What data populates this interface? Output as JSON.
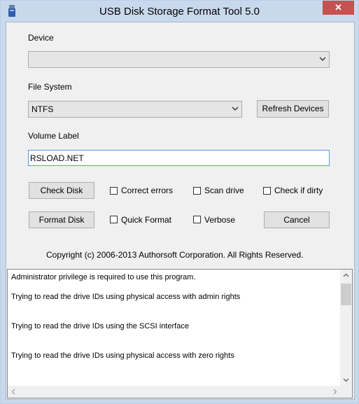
{
  "window": {
    "title": "USB Disk Storage Format Tool 5.0",
    "close_glyph": "✕",
    "app_icon": "usb-drive-icon"
  },
  "device": {
    "label": "Device",
    "selected": ""
  },
  "file_system": {
    "label": "File System",
    "selected": "NTFS"
  },
  "buttons": {
    "refresh": "Refresh Devices",
    "check_disk": "Check Disk",
    "format_disk": "Format Disk",
    "cancel": "Cancel"
  },
  "volume_label": {
    "label": "Volume Label",
    "value": "RSLOAD.NET"
  },
  "options": {
    "correct_errors": "Correct errors",
    "scan_drive": "Scan drive",
    "check_if_dirty": "Check if dirty",
    "quick_format": "Quick Format",
    "verbose": "Verbose"
  },
  "copyright": "Copyright (c) 2006-2013 Authorsoft Corporation. All Rights Reserved.",
  "log": [
    "Administrator privilege is required to use this program.",
    "Trying to read the drive IDs using physical access with admin rights",
    "Trying to read the drive IDs using the SCSI interface",
    "Trying to read the drive IDs using physical access with zero rights"
  ],
  "colors": {
    "titlebar": "#c9d9ec",
    "close_button": "#c75050",
    "panel": "#f0f0f0",
    "input_focus_border": "#569de5"
  }
}
